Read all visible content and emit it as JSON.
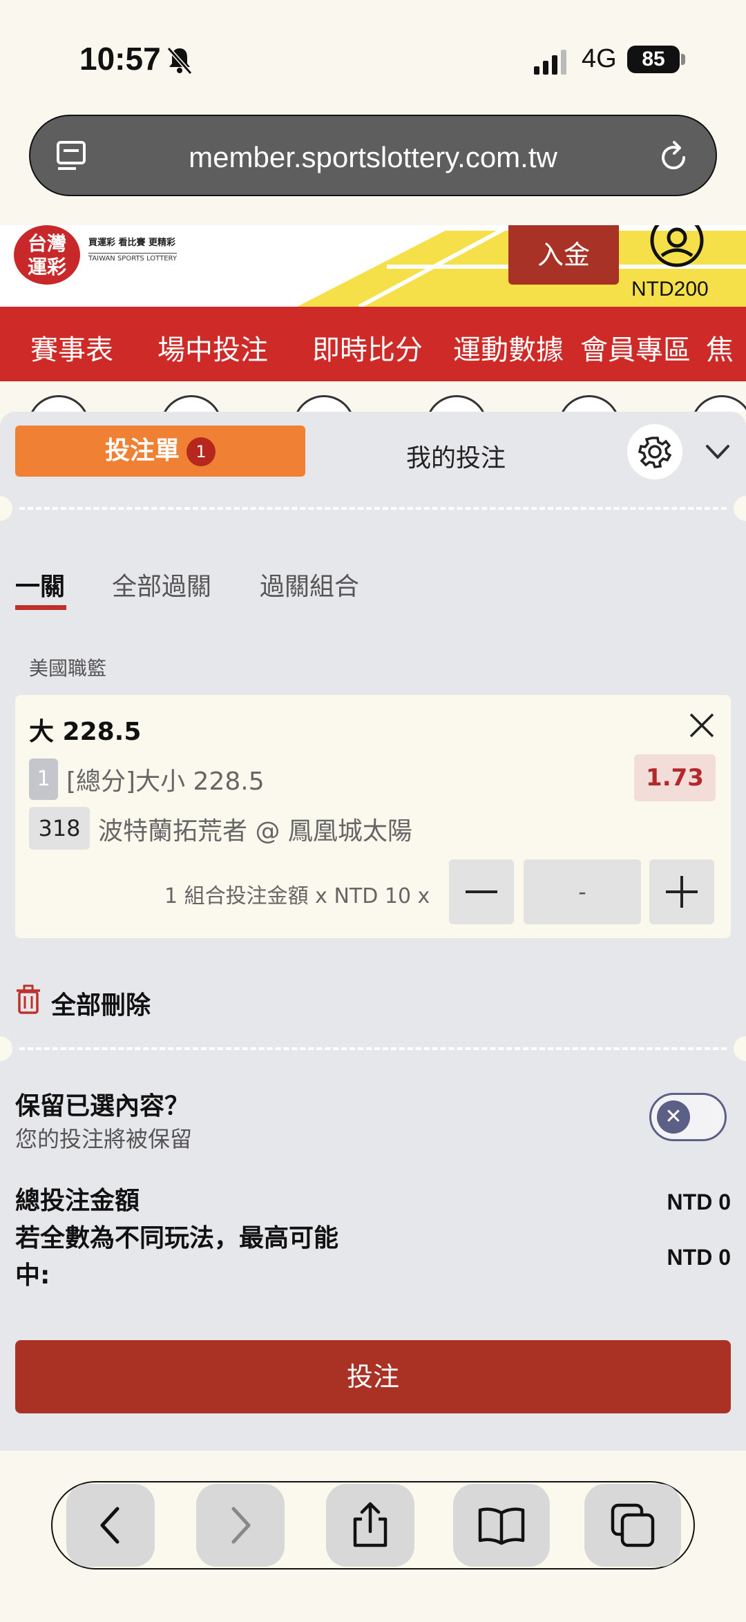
{
  "status_bar": {
    "time": "10:57",
    "network": "4G",
    "battery": "85"
  },
  "browser": {
    "url": "member.sportslottery.com.tw"
  },
  "site": {
    "logo_text_top": "台灣",
    "logo_text_bottom": "運彩",
    "tagline": "買運彩 看比賽 更精彩",
    "subtitle": "TAIWAN SPORTS LOTTERY",
    "deposit_label": "入金",
    "balance": "NTD200"
  },
  "nav": {
    "items": [
      "賽事表",
      "場中投注",
      "即時比分",
      "運動數據",
      "會員專區",
      "焦"
    ]
  },
  "bet_panel": {
    "slip_tab_label": "投注單",
    "slip_count": "1",
    "my_bets_label": "我的投注",
    "subtabs": [
      "一關",
      "全部過關",
      "過關組合"
    ],
    "league": "美國職籃",
    "bet": {
      "title": "大 228.5",
      "selection_number": "1",
      "market": "[總分]大小 228.5",
      "odds": "1.73",
      "match_number": "318",
      "match_name": "波特蘭拓荒者 @ 鳳凰城太陽",
      "stake_label": "1 組合投注金額 x NTD 10 x",
      "stake_value": "-"
    },
    "delete_all_label": "全部刪除",
    "keep_title": "保留已選內容？",
    "keep_subtitle": "您的投注將被保留",
    "keep_toggle_on": false,
    "total_label": "總投注金額",
    "total_value": "NTD 0",
    "max_win_label_1": "若全數為不同玩法，最高可能",
    "max_win_label_2": "中:",
    "max_win_value": "NTD 0",
    "submit_label": "投注"
  },
  "colors": {
    "brand_red": "#cd2a28",
    "slip_orange": "#f08034",
    "submit_red": "#a93224",
    "odds_red": "#b3282c"
  },
  "icons": [
    "bell-muted-icon",
    "signal-icon",
    "tabs-icon",
    "reload-icon",
    "user-icon",
    "gear-icon",
    "chevron-down-icon",
    "close-icon",
    "minus-icon",
    "plus-icon",
    "trash-icon",
    "back-icon",
    "forward-icon",
    "share-icon",
    "bookmarks-icon",
    "tabs-overview-icon"
  ]
}
